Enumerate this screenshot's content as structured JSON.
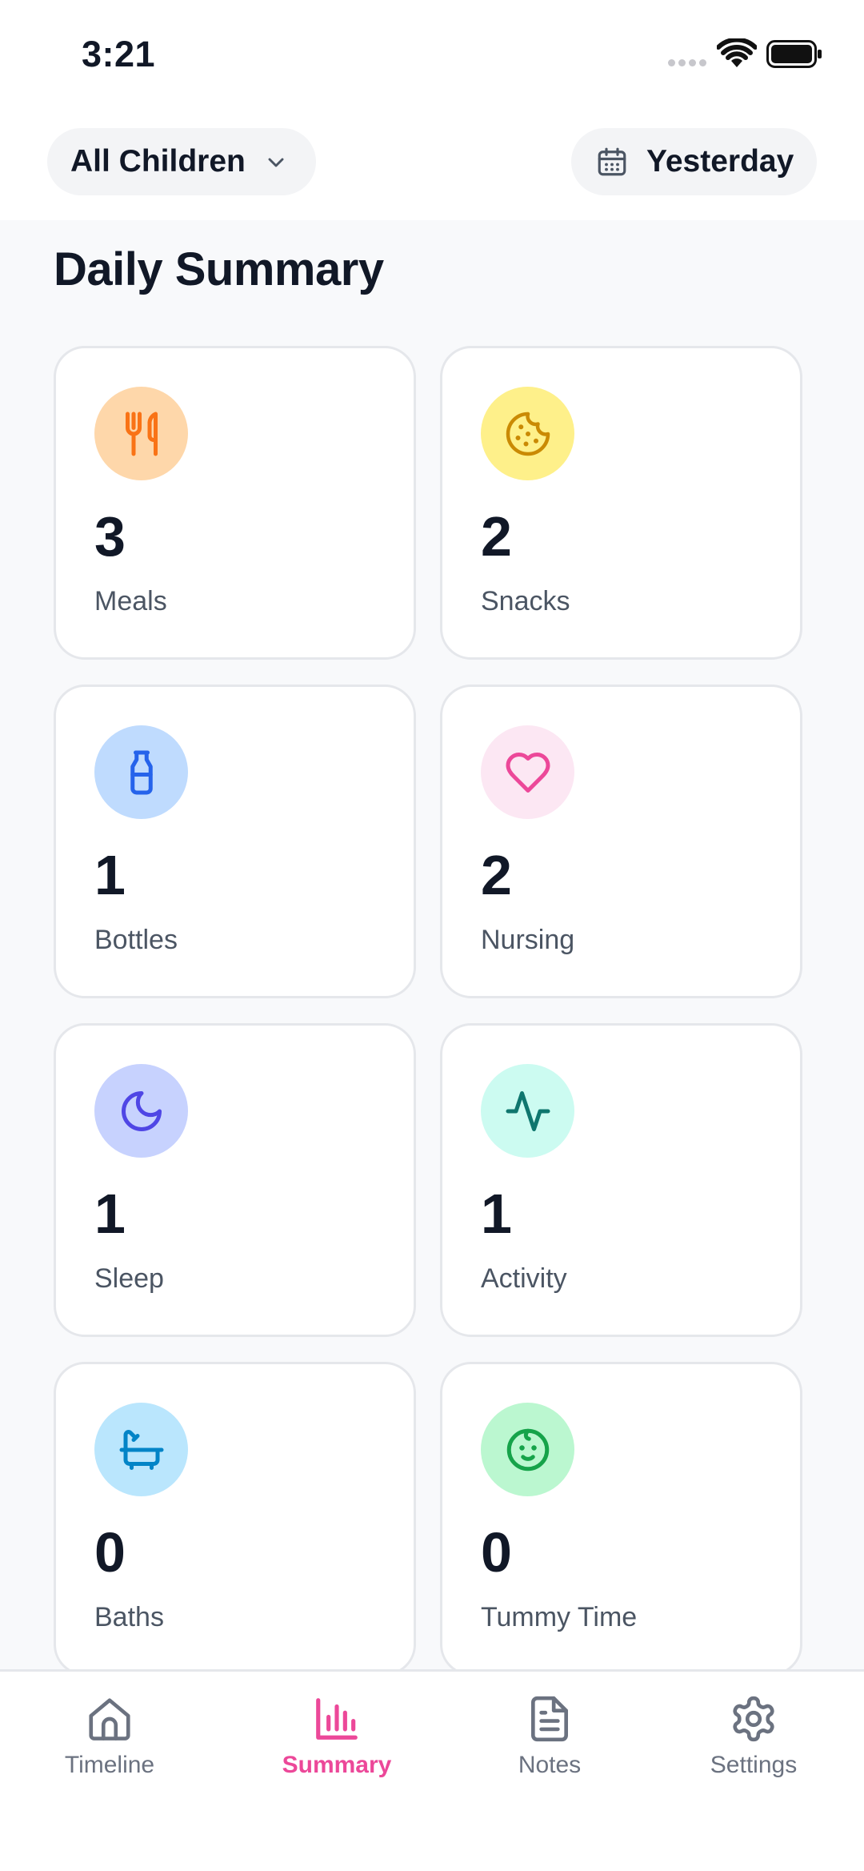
{
  "status_bar": {
    "time": "3:21"
  },
  "header": {
    "child_select_label": "All Children",
    "date_select_label": "Yesterday"
  },
  "page": {
    "title": "Daily Summary"
  },
  "cards": [
    {
      "count": "3",
      "label": "Meals",
      "icon": "utensils-icon",
      "bg": "#fed7aa",
      "fg": "#f97316"
    },
    {
      "count": "2",
      "label": "Snacks",
      "icon": "cookie-icon",
      "bg": "#fef08a",
      "fg": "#ca8a04"
    },
    {
      "count": "1",
      "label": "Bottles",
      "icon": "bottle-icon",
      "bg": "#bfdbfe",
      "fg": "#2563eb"
    },
    {
      "count": "2",
      "label": "Nursing",
      "icon": "heart-icon",
      "bg": "#fce7f3",
      "fg": "#ec4899"
    },
    {
      "count": "1",
      "label": "Sleep",
      "icon": "moon-icon",
      "bg": "#c7d2fe",
      "fg": "#4f46e5"
    },
    {
      "count": "1",
      "label": "Activity",
      "icon": "activity-icon",
      "bg": "#ccfbf1",
      "fg": "#0f766e"
    },
    {
      "count": "0",
      "label": "Baths",
      "icon": "bathtub-icon",
      "bg": "#bae6fd",
      "fg": "#0284c7"
    },
    {
      "count": "0",
      "label": "Tummy Time",
      "icon": "baby-icon",
      "bg": "#bbf7d0",
      "fg": "#16a34a"
    }
  ],
  "tabs": [
    {
      "label": "Timeline",
      "icon": "home-icon",
      "active": false
    },
    {
      "label": "Summary",
      "icon": "bar-chart-icon",
      "active": true
    },
    {
      "label": "Notes",
      "icon": "document-icon",
      "active": false
    },
    {
      "label": "Settings",
      "icon": "gear-icon",
      "active": false
    }
  ],
  "colors": {
    "accent": "#ec4899",
    "text": "#111827",
    "muted": "#6b7280",
    "card_border": "#e5e7eb",
    "background": "#f8f9fb"
  }
}
